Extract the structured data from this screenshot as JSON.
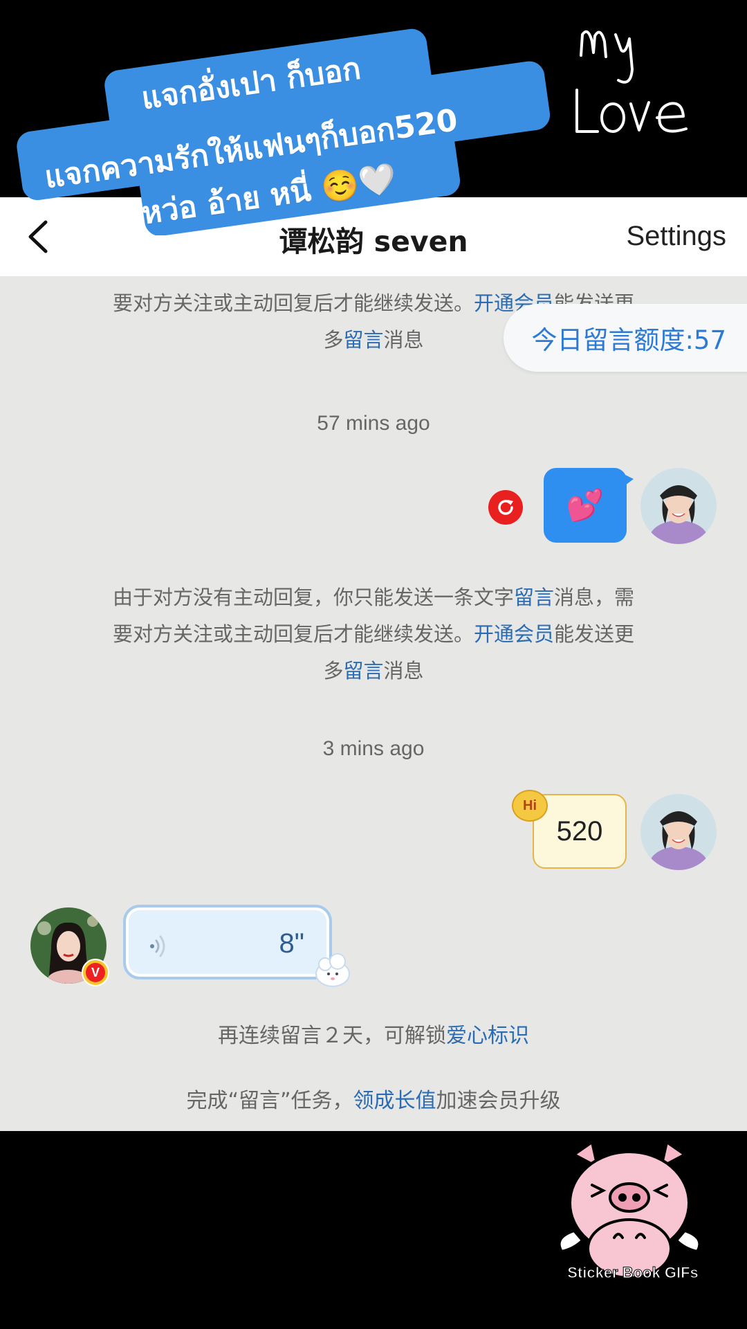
{
  "overlay": {
    "banner_line1": "แจกอั่งเปา ก็บอก",
    "banner_line2": "แจกความรักให้แฟนๆก็บอก520",
    "banner_line3": "หว่อ อ้าย หนี่",
    "banner_emoji": "☺️🤍",
    "sticker_text": "my Love",
    "pig_caption": "Sticker Book GIFs"
  },
  "navbar": {
    "title": "谭松韵 seven",
    "settings_label": "Settings"
  },
  "chat": {
    "quota": "今日留言额度:57",
    "notice_partial": {
      "line2_a": "要对方关注或主动回复后才能继续发送。",
      "line2_link": "开通会员",
      "line2_b": "能发送更",
      "line3_a": "多",
      "line3_link": "留言",
      "line3_b": "消息"
    },
    "timestamp1": "57 mins ago",
    "message1_emoji": "💕",
    "notice": {
      "line1_a": "由于对方没有主动回复，你只能发送一条文字",
      "line1_link": "留言",
      "line1_b": "消息，需",
      "line2_a": "要对方关注或主动回复后才能继续发送。",
      "line2_link": "开通会员",
      "line2_b": "能发送更",
      "line3_a": "多",
      "line3_link": "留言",
      "line3_b": "消息"
    },
    "timestamp2": "3 mins ago",
    "hi_badge": "Hi",
    "message2_text": "520",
    "voice_duration": "8\"",
    "info1": {
      "a": "再连续留言２天，可解锁",
      "link": "爱心标识"
    },
    "info2": {
      "a": "完成“留言”任务，",
      "link": "领成长值",
      "b": "加速会员升级"
    },
    "vip_badge": "V"
  },
  "colors": {
    "accent_blue": "#2a6bb3",
    "bubble_blue": "#2e8ff0",
    "banner_blue": "#3a8fe3",
    "chat_bg": "#e7e8e6"
  }
}
